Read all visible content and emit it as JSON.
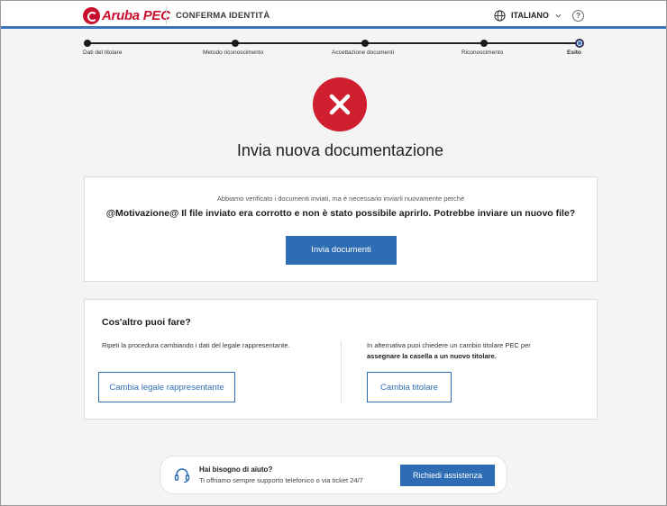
{
  "header": {
    "brand": "Aruba PEC",
    "title": "CONFERMA IDENTITÀ",
    "language": "ITALIANO",
    "help_symbol": "?"
  },
  "stepper": {
    "steps": [
      {
        "label": "Dati del titolare",
        "current": false
      },
      {
        "label": "Metodo riconoscimento",
        "current": false
      },
      {
        "label": "Accettazione documenti",
        "current": false
      },
      {
        "label": "Riconoscimento",
        "current": false
      },
      {
        "label": "Esito",
        "current": true
      }
    ]
  },
  "result": {
    "icon": "error-x-icon",
    "title": "Invia nuova documentazione"
  },
  "reason_card": {
    "notice": "Abbiamo verificato i documenti inviati, ma è necessario inviarli nuovamente perchè",
    "reason": "@Motivazione@ Il file inviato era corrotto e non è stato possibile aprirlo. Potrebbe inviare un nuovo file?",
    "button": "Invia documenti"
  },
  "options_card": {
    "title": "Cos'altro puoi fare?",
    "left_text": "Ripeti la procedura cambiando i dati del legale rappresentante.",
    "left_button": "Cambia legale rappresentante",
    "right_text": "In alternativa puoi chiedere un cambio titolare PEC per",
    "right_text_bold": "assegnare la casella a un nuovo titolare.",
    "right_button": "Cambia titolare"
  },
  "help": {
    "title": "Hai bisogno di aiuto?",
    "subtitle": "Ti offriamo sempre supporto telefonico o via ticket 24/7",
    "button": "Richiedi assistenza"
  },
  "colors": {
    "accent": "#2e6db4",
    "error": "#d0202f",
    "brand": "#c8102e"
  }
}
